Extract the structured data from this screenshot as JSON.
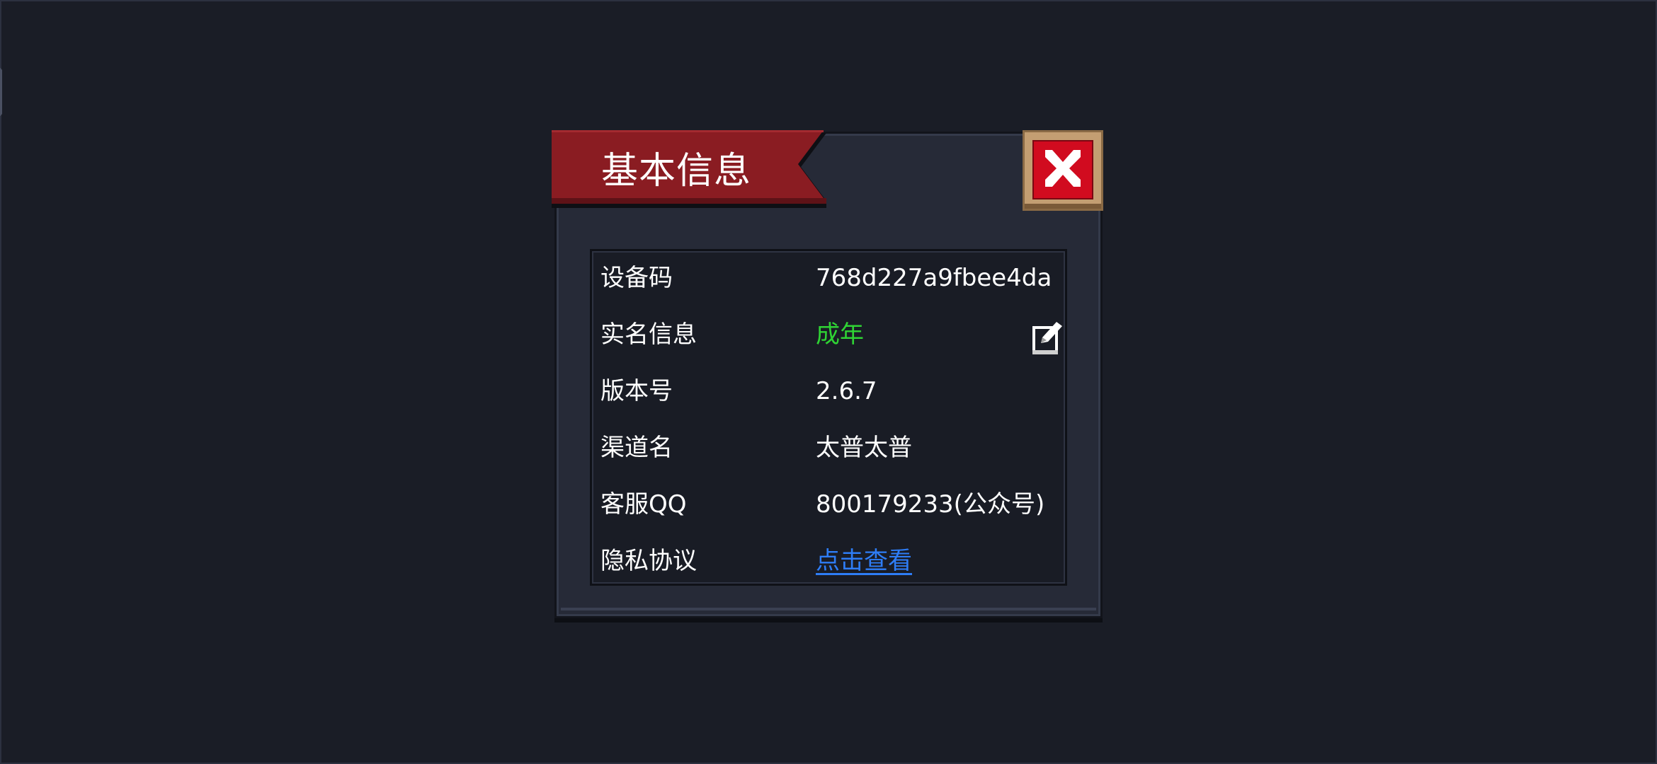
{
  "dialog": {
    "title": "基本信息",
    "close_icon": "close-x-icon",
    "rows": [
      {
        "label": "设备码",
        "value": "768d227a9fbee4da"
      },
      {
        "label": "实名信息",
        "value": "成年",
        "value_color": "#2fd334",
        "action_icon": "edit-icon"
      },
      {
        "label": "版本号",
        "value": "2.6.7"
      },
      {
        "label": "渠道名",
        "value": "太普太普"
      },
      {
        "label": "客服QQ",
        "value": "800179233(公众号)"
      },
      {
        "label": "隐私协议",
        "value": "点击查看",
        "value_color": "#2e7df6",
        "is_link": true
      }
    ]
  },
  "colors": {
    "background": "#1a1d26",
    "panel": "#262a37",
    "ribbon": "#8a1c22",
    "close_button_fill": "#d10b1f",
    "close_button_frame": "#b8946a"
  }
}
